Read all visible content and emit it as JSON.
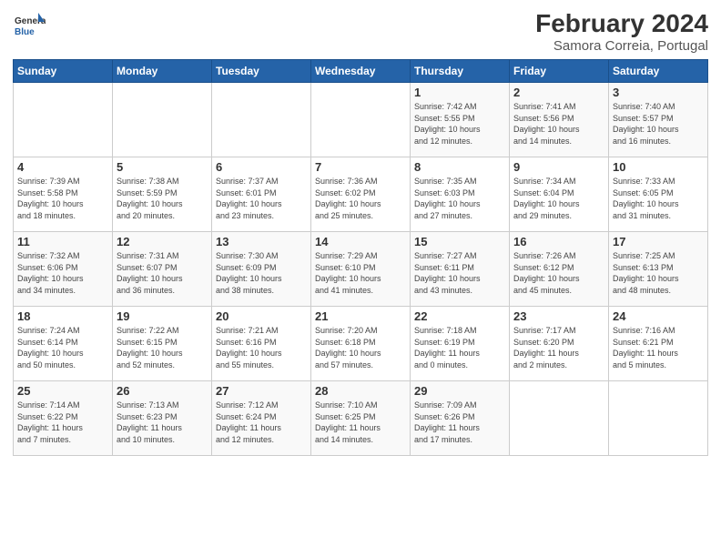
{
  "logo": {
    "line1": "General",
    "line2": "Blue"
  },
  "title": "February 2024",
  "subtitle": "Samora Correia, Portugal",
  "days_of_week": [
    "Sunday",
    "Monday",
    "Tuesday",
    "Wednesday",
    "Thursday",
    "Friday",
    "Saturday"
  ],
  "weeks": [
    [
      {
        "day": "",
        "info": ""
      },
      {
        "day": "",
        "info": ""
      },
      {
        "day": "",
        "info": ""
      },
      {
        "day": "",
        "info": ""
      },
      {
        "day": "1",
        "info": "Sunrise: 7:42 AM\nSunset: 5:55 PM\nDaylight: 10 hours\nand 12 minutes."
      },
      {
        "day": "2",
        "info": "Sunrise: 7:41 AM\nSunset: 5:56 PM\nDaylight: 10 hours\nand 14 minutes."
      },
      {
        "day": "3",
        "info": "Sunrise: 7:40 AM\nSunset: 5:57 PM\nDaylight: 10 hours\nand 16 minutes."
      }
    ],
    [
      {
        "day": "4",
        "info": "Sunrise: 7:39 AM\nSunset: 5:58 PM\nDaylight: 10 hours\nand 18 minutes."
      },
      {
        "day": "5",
        "info": "Sunrise: 7:38 AM\nSunset: 5:59 PM\nDaylight: 10 hours\nand 20 minutes."
      },
      {
        "day": "6",
        "info": "Sunrise: 7:37 AM\nSunset: 6:01 PM\nDaylight: 10 hours\nand 23 minutes."
      },
      {
        "day": "7",
        "info": "Sunrise: 7:36 AM\nSunset: 6:02 PM\nDaylight: 10 hours\nand 25 minutes."
      },
      {
        "day": "8",
        "info": "Sunrise: 7:35 AM\nSunset: 6:03 PM\nDaylight: 10 hours\nand 27 minutes."
      },
      {
        "day": "9",
        "info": "Sunrise: 7:34 AM\nSunset: 6:04 PM\nDaylight: 10 hours\nand 29 minutes."
      },
      {
        "day": "10",
        "info": "Sunrise: 7:33 AM\nSunset: 6:05 PM\nDaylight: 10 hours\nand 31 minutes."
      }
    ],
    [
      {
        "day": "11",
        "info": "Sunrise: 7:32 AM\nSunset: 6:06 PM\nDaylight: 10 hours\nand 34 minutes."
      },
      {
        "day": "12",
        "info": "Sunrise: 7:31 AM\nSunset: 6:07 PM\nDaylight: 10 hours\nand 36 minutes."
      },
      {
        "day": "13",
        "info": "Sunrise: 7:30 AM\nSunset: 6:09 PM\nDaylight: 10 hours\nand 38 minutes."
      },
      {
        "day": "14",
        "info": "Sunrise: 7:29 AM\nSunset: 6:10 PM\nDaylight: 10 hours\nand 41 minutes."
      },
      {
        "day": "15",
        "info": "Sunrise: 7:27 AM\nSunset: 6:11 PM\nDaylight: 10 hours\nand 43 minutes."
      },
      {
        "day": "16",
        "info": "Sunrise: 7:26 AM\nSunset: 6:12 PM\nDaylight: 10 hours\nand 45 minutes."
      },
      {
        "day": "17",
        "info": "Sunrise: 7:25 AM\nSunset: 6:13 PM\nDaylight: 10 hours\nand 48 minutes."
      }
    ],
    [
      {
        "day": "18",
        "info": "Sunrise: 7:24 AM\nSunset: 6:14 PM\nDaylight: 10 hours\nand 50 minutes."
      },
      {
        "day": "19",
        "info": "Sunrise: 7:22 AM\nSunset: 6:15 PM\nDaylight: 10 hours\nand 52 minutes."
      },
      {
        "day": "20",
        "info": "Sunrise: 7:21 AM\nSunset: 6:16 PM\nDaylight: 10 hours\nand 55 minutes."
      },
      {
        "day": "21",
        "info": "Sunrise: 7:20 AM\nSunset: 6:18 PM\nDaylight: 10 hours\nand 57 minutes."
      },
      {
        "day": "22",
        "info": "Sunrise: 7:18 AM\nSunset: 6:19 PM\nDaylight: 11 hours\nand 0 minutes."
      },
      {
        "day": "23",
        "info": "Sunrise: 7:17 AM\nSunset: 6:20 PM\nDaylight: 11 hours\nand 2 minutes."
      },
      {
        "day": "24",
        "info": "Sunrise: 7:16 AM\nSunset: 6:21 PM\nDaylight: 11 hours\nand 5 minutes."
      }
    ],
    [
      {
        "day": "25",
        "info": "Sunrise: 7:14 AM\nSunset: 6:22 PM\nDaylight: 11 hours\nand 7 minutes."
      },
      {
        "day": "26",
        "info": "Sunrise: 7:13 AM\nSunset: 6:23 PM\nDaylight: 11 hours\nand 10 minutes."
      },
      {
        "day": "27",
        "info": "Sunrise: 7:12 AM\nSunset: 6:24 PM\nDaylight: 11 hours\nand 12 minutes."
      },
      {
        "day": "28",
        "info": "Sunrise: 7:10 AM\nSunset: 6:25 PM\nDaylight: 11 hours\nand 14 minutes."
      },
      {
        "day": "29",
        "info": "Sunrise: 7:09 AM\nSunset: 6:26 PM\nDaylight: 11 hours\nand 17 minutes."
      },
      {
        "day": "",
        "info": ""
      },
      {
        "day": "",
        "info": ""
      }
    ]
  ]
}
